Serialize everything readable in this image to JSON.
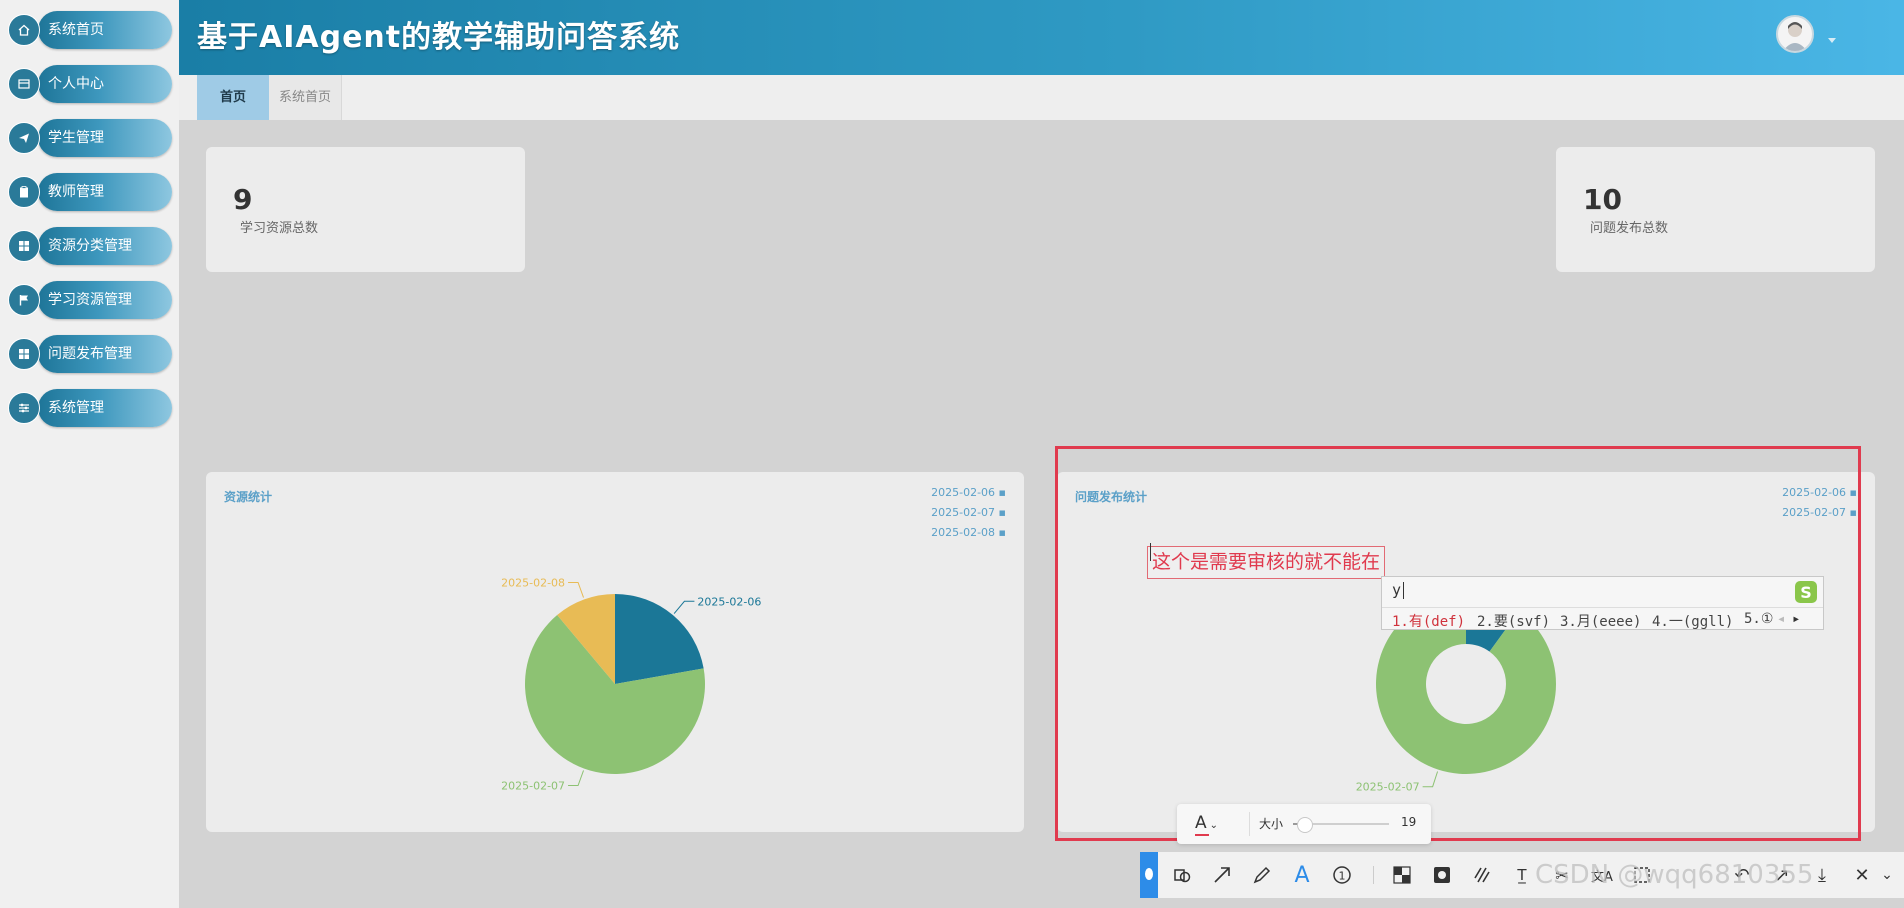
{
  "header": {
    "title": "基于AIAgent的教学辅助问答系统"
  },
  "sidebar": {
    "items": [
      {
        "label": "系统首页",
        "icon": "home-icon"
      },
      {
        "label": "个人中心",
        "icon": "card-icon"
      },
      {
        "label": "学生管理",
        "icon": "send-icon"
      },
      {
        "label": "教师管理",
        "icon": "clipboard-icon"
      },
      {
        "label": "资源分类管理",
        "icon": "grid-icon"
      },
      {
        "label": "学习资源管理",
        "icon": "flag-icon"
      },
      {
        "label": "问题发布管理",
        "icon": "grid-icon"
      },
      {
        "label": "系统管理",
        "icon": "sliders-icon"
      }
    ]
  },
  "tabs": [
    {
      "label": "首页",
      "active": true
    },
    {
      "label": "系统首页",
      "active": false
    }
  ],
  "stats": [
    {
      "value": "9",
      "label": "学习资源总数"
    },
    {
      "value": "10",
      "label": "问题发布总数"
    }
  ],
  "charts": {
    "resources_title": "资源统计",
    "questions_title": "问题发布统计"
  },
  "chart_data": [
    {
      "type": "pie",
      "title": "资源统计",
      "categories": [
        "2025-02-06",
        "2025-02-07",
        "2025-02-08"
      ],
      "values": [
        2,
        6,
        1
      ],
      "colors": [
        "#1b7797",
        "#8dc273",
        "#e8bb55"
      ],
      "legend_position": "top-right"
    },
    {
      "type": "pie",
      "subtype": "donut",
      "title": "问题发布统计",
      "categories": [
        "2025-02-06",
        "2025-02-07"
      ],
      "values": [
        1,
        9
      ],
      "colors": [
        "#1b7797",
        "#8dc273"
      ],
      "legend_position": "top-right"
    }
  ],
  "overlay": {
    "typed_text": "这个是需要审核的就不能在",
    "ime": {
      "input": "y",
      "candidates": [
        "1.有(def)",
        "2.要(svf)",
        "3.月(eeee)",
        "4.一(ggll)",
        "5.①"
      ]
    },
    "fontbar": {
      "size_label": "大小",
      "size_value": "19",
      "font_color": "#e03a4e"
    },
    "watermark": "CSDN @wqq6810355"
  }
}
